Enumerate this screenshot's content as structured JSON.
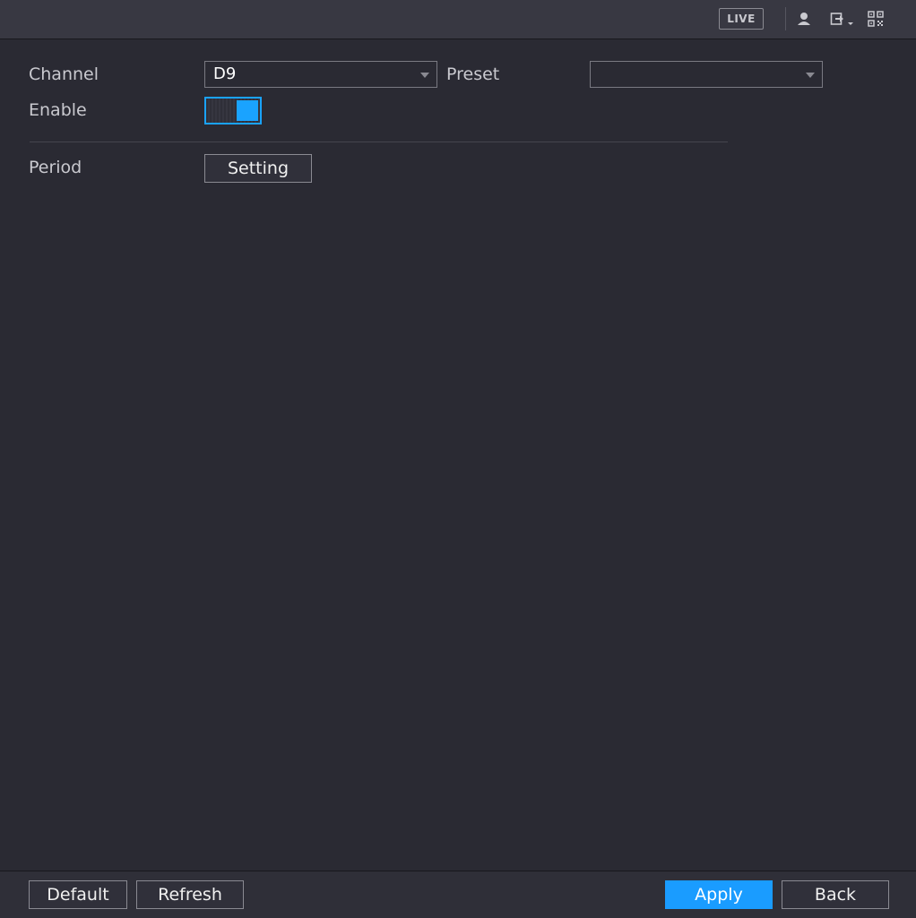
{
  "header": {
    "live_label": "LIVE",
    "icons": [
      "user-icon",
      "logout-icon",
      "qr-code-icon"
    ]
  },
  "form": {
    "channel_label": "Channel",
    "channel_value": "D9",
    "preset_label": "Preset",
    "preset_value": "",
    "enable_label": "Enable",
    "enable_on": true,
    "period_label": "Period",
    "setting_button": "Setting"
  },
  "footer": {
    "default_button": "Default",
    "refresh_button": "Refresh",
    "apply_button": "Apply",
    "back_button": "Back"
  },
  "colors": {
    "accent": "#1a9cff",
    "background": "#2a2a33",
    "topbar": "#383842"
  }
}
